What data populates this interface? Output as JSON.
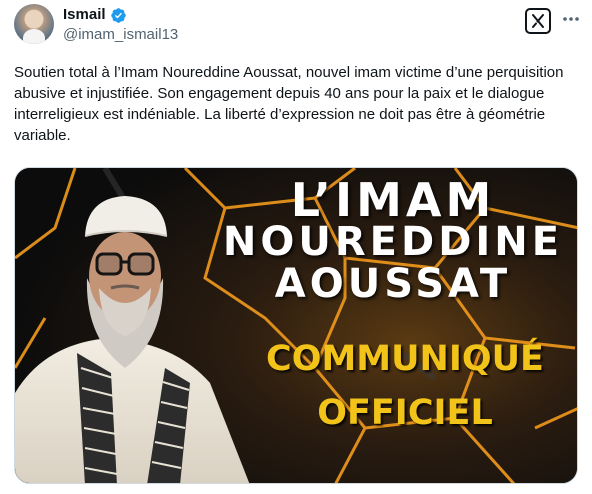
{
  "author": {
    "display_name": "Ismail",
    "handle": "@imam_ismail13"
  },
  "icons": {
    "avatar": "profile-photo",
    "verified": "verified-badge-icon",
    "grok": "grok-icon",
    "more": "more-options-icon"
  },
  "colors": {
    "verified_blue": "#1d9bf0",
    "text": "#0f1419",
    "secondary_text": "#536471",
    "headline_gold": "#f2c318"
  },
  "post": {
    "text": "Soutien total à l’Imam Noureddine Aoussat, nouvel imam victime d’une perquisition abusive et injustifiée. Son engagement depuis 40 ans pour la paix et le dialogue interreligieux est indéniable. La liberté d’expression ne doit pas être à géométrie variable."
  },
  "media": {
    "headline_line1": "L’IMAM",
    "headline_line2": "NOUREDDINE",
    "headline_line3": "AOUSSAT",
    "subtitle_line1": "COMMUNIQUÉ",
    "subtitle_line2": "OFFICIEL"
  }
}
